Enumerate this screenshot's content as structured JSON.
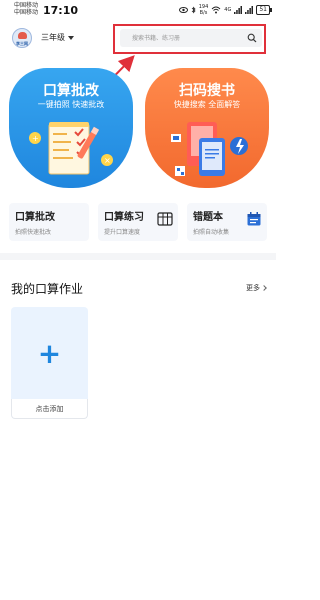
{
  "status_bar": {
    "carrier_line1": "中国移动",
    "carrier_line2": "中国移动",
    "time": "17:10",
    "net_speed_value": "194",
    "net_speed_unit": "B/s",
    "signal_label": "4G",
    "battery": "51"
  },
  "header": {
    "logo_text": "李三网",
    "grade": "三年级",
    "search_placeholder": "搜索书籍、练习册"
  },
  "feature_cards": [
    {
      "title": "口算批改",
      "subtitle": "一键拍照 快速批改",
      "color": "#2b95e9"
    },
    {
      "title": "扫码搜书",
      "subtitle": "快捷搜索 全面解答",
      "color": "#f97a3c"
    }
  ],
  "tools": [
    {
      "title": "口算批改",
      "subtitle": "拍照快速批改"
    },
    {
      "title": "口算练习",
      "subtitle": "提升口算速度"
    },
    {
      "title": "错题本",
      "subtitle": "拍照自动收集"
    }
  ],
  "homework": {
    "title": "我的口算作业",
    "more_label": "更多",
    "add_label": "点击添加",
    "add_icon": "+"
  },
  "annotation": {
    "highlight_color": "#e0303a"
  }
}
